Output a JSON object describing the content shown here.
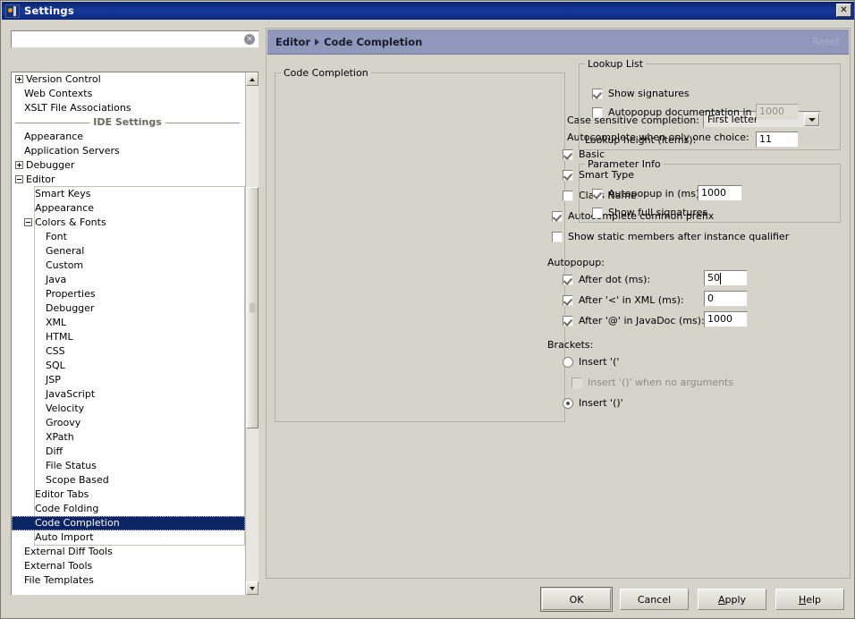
{
  "window": {
    "title": "Settings",
    "icon": "intellij-icon",
    "close_label": "✕"
  },
  "search": {
    "value": "",
    "placeholder": "",
    "clear_icon": "×"
  },
  "tree": {
    "separator_label": "IDE Settings",
    "selected": "Code Completion",
    "items": [
      {
        "label": "Version Control",
        "indent": 0,
        "toggle": "plus"
      },
      {
        "label": "Web Contexts",
        "indent": 1,
        "toggle": "none"
      },
      {
        "label": "XSLT File Associations",
        "indent": 1,
        "toggle": "none"
      },
      {
        "label": "Appearance",
        "indent": 1,
        "toggle": "none"
      },
      {
        "label": "Application Servers",
        "indent": 1,
        "toggle": "none"
      },
      {
        "label": "Debugger",
        "indent": 0,
        "toggle": "plus"
      },
      {
        "label": "Editor",
        "indent": 0,
        "toggle": "minus"
      },
      {
        "label": "Smart Keys",
        "indent": 2,
        "toggle": "none"
      },
      {
        "label": "Appearance",
        "indent": 2,
        "toggle": "none"
      },
      {
        "label": "Colors & Fonts",
        "indent": 1,
        "toggle": "minus"
      },
      {
        "label": "Font",
        "indent": 3,
        "toggle": "none"
      },
      {
        "label": "General",
        "indent": 3,
        "toggle": "none"
      },
      {
        "label": "Custom",
        "indent": 3,
        "toggle": "none"
      },
      {
        "label": "Java",
        "indent": 3,
        "toggle": "none"
      },
      {
        "label": "Properties",
        "indent": 3,
        "toggle": "none"
      },
      {
        "label": "Debugger",
        "indent": 3,
        "toggle": "none"
      },
      {
        "label": "XML",
        "indent": 3,
        "toggle": "none"
      },
      {
        "label": "HTML",
        "indent": 3,
        "toggle": "none"
      },
      {
        "label": "CSS",
        "indent": 3,
        "toggle": "none"
      },
      {
        "label": "SQL",
        "indent": 3,
        "toggle": "none"
      },
      {
        "label": "JSP",
        "indent": 3,
        "toggle": "none"
      },
      {
        "label": "JavaScript",
        "indent": 3,
        "toggle": "none"
      },
      {
        "label": "Velocity",
        "indent": 3,
        "toggle": "none"
      },
      {
        "label": "Groovy",
        "indent": 3,
        "toggle": "none"
      },
      {
        "label": "XPath",
        "indent": 3,
        "toggle": "none"
      },
      {
        "label": "Diff",
        "indent": 3,
        "toggle": "none"
      },
      {
        "label": "File Status",
        "indent": 3,
        "toggle": "none"
      },
      {
        "label": "Scope Based",
        "indent": 3,
        "toggle": "none"
      },
      {
        "label": "Editor Tabs",
        "indent": 2,
        "toggle": "none"
      },
      {
        "label": "Code Folding",
        "indent": 2,
        "toggle": "none"
      },
      {
        "label": "Code Completion",
        "indent": 2,
        "toggle": "none"
      },
      {
        "label": "Auto Import",
        "indent": 2,
        "toggle": "none"
      },
      {
        "label": "External Diff Tools",
        "indent": 1,
        "toggle": "none"
      },
      {
        "label": "External Tools",
        "indent": 1,
        "toggle": "none"
      },
      {
        "label": "File Templates",
        "indent": 1,
        "toggle": "none"
      }
    ]
  },
  "header": {
    "crumb_root": "Editor",
    "crumb_leaf": "Code Completion",
    "reset_label": "Reset"
  },
  "code_completion": {
    "legend": "Code Completion",
    "case_sensitive_label": "Case sensitive completion:",
    "case_sensitive_value": "First letter",
    "autocomplete_header": "Autocomplete when only one choice:",
    "basic_label": "Basic",
    "basic_checked": true,
    "smart_type_label": "Smart Type",
    "smart_type_checked": true,
    "class_name_label": "Class Name",
    "class_name_checked": false,
    "common_prefix_label": "Autocomplete common prefix",
    "common_prefix_checked": true,
    "static_members_label": "Show static members after instance qualifier",
    "static_members_checked": false,
    "autopopup_header": "Autopopup:",
    "after_dot_label": "After dot (ms):",
    "after_dot_checked": true,
    "after_dot_value": "50",
    "after_xml_label": "After '<' in XML (ms):",
    "after_xml_checked": true,
    "after_xml_value": "0",
    "after_javadoc_label": "After '@' in JavaDoc (ms):",
    "after_javadoc_checked": true,
    "after_javadoc_value": "1000",
    "brackets_header": "Brackets:",
    "insert_paren_label": "Insert '('",
    "insert_paren_selected": false,
    "insert_no_args_label": "Insert '()' when no arguments",
    "insert_no_args_checked": false,
    "insert_no_args_disabled": true,
    "insert_pair_label": "Insert '()'",
    "insert_pair_selected": true
  },
  "lookup_list": {
    "legend": "Lookup List",
    "show_signatures_label": "Show signatures",
    "show_signatures_checked": true,
    "autopopup_doc_label": "Autopopup documentation in (ms):",
    "autopopup_doc_checked": false,
    "autopopup_doc_value": "1000",
    "autopopup_doc_disabled": true,
    "lookup_height_label": "Lookup height (items):",
    "lookup_height_value": "11"
  },
  "parameter_info": {
    "legend": "Parameter Info",
    "autopopup_label": "Autopopup in (ms):",
    "autopopup_checked": true,
    "autopopup_value": "1000",
    "full_signatures_label": "Show full signatures",
    "full_signatures_checked": false
  },
  "buttons": {
    "ok": "OK",
    "cancel": "Cancel",
    "apply_pre": "",
    "apply_mn": "A",
    "apply_post": "pply",
    "help_mn": "H",
    "help_post": "elp"
  },
  "colors": {
    "titlebar": "#15389b",
    "header_bar": "#8f97ba",
    "selection": "#0a2464",
    "dialog_bg": "#d6d3ca"
  }
}
